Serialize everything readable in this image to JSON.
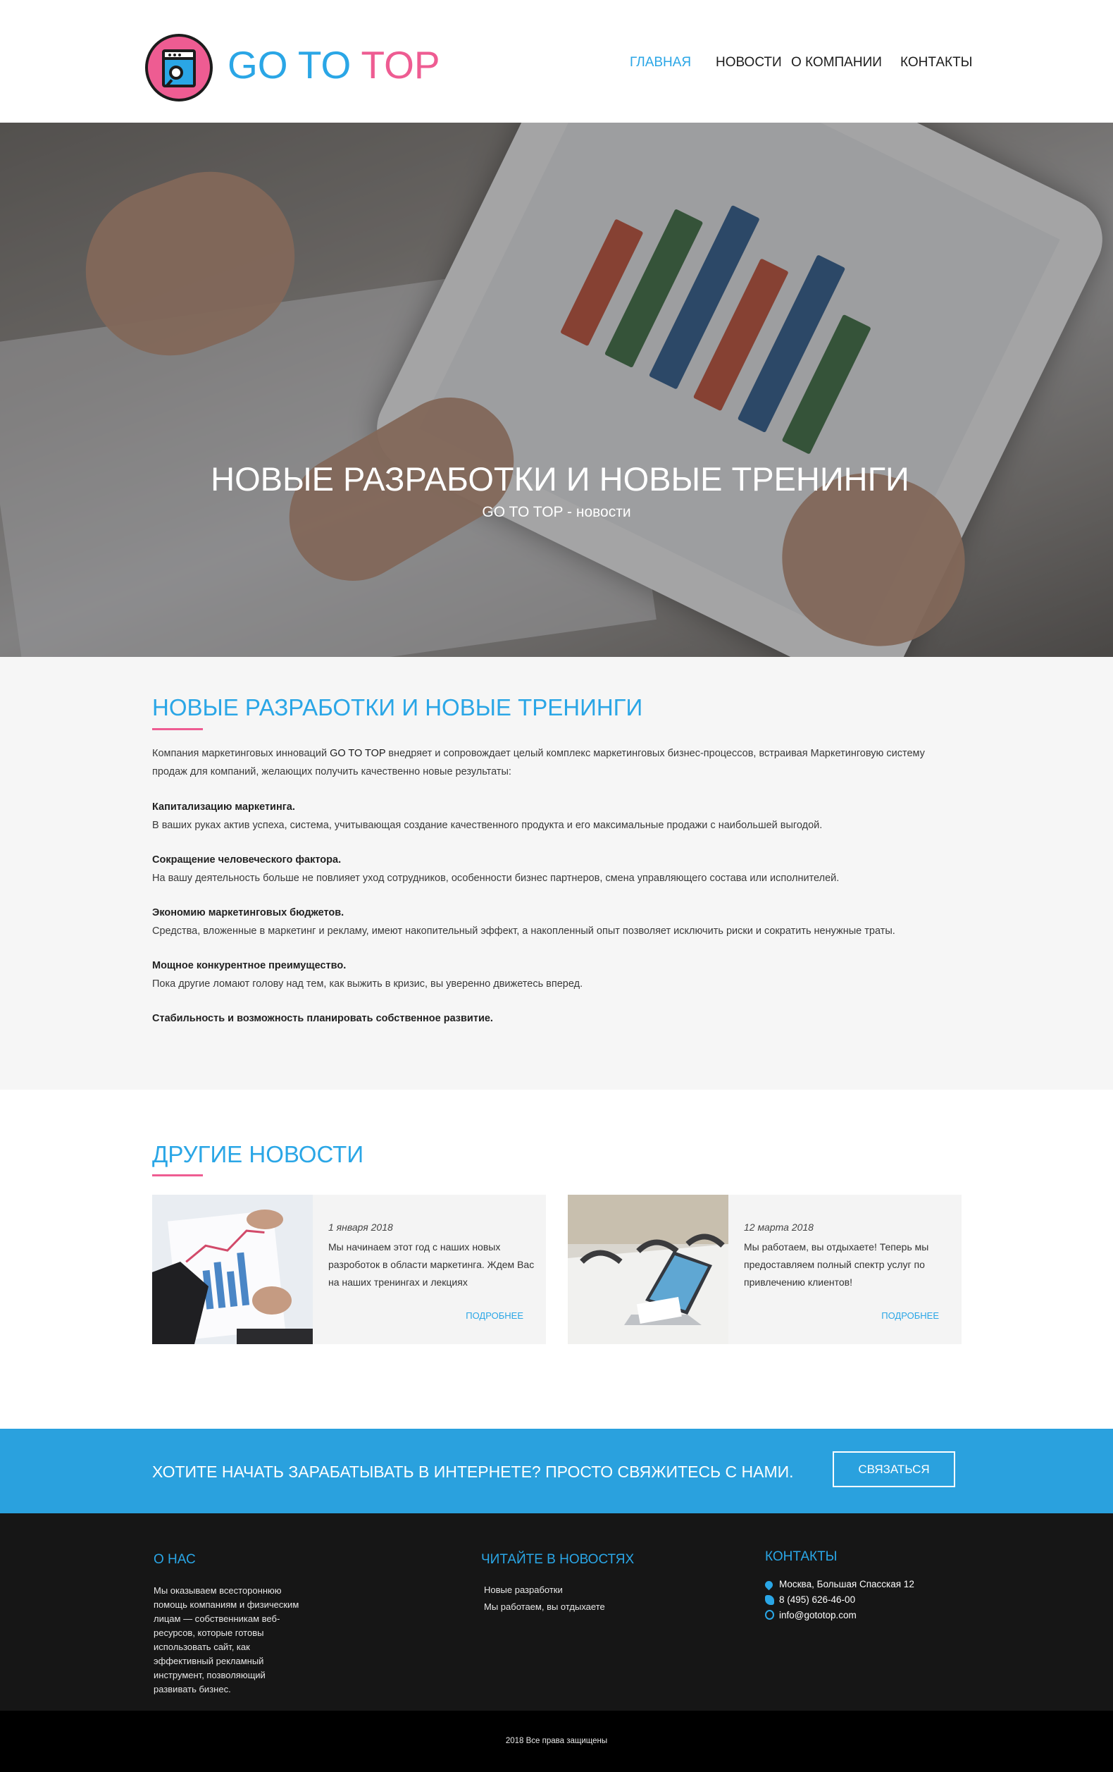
{
  "header": {
    "logo": {
      "word1": "GO TO",
      "word2": "TOP"
    },
    "nav": [
      {
        "label": "ГЛАВНАЯ",
        "active": true
      },
      {
        "label": "НОВОСТИ",
        "active": false
      },
      {
        "label": "О КОМПАНИИ",
        "active": false
      },
      {
        "label": "КОНТАКТЫ",
        "active": false
      }
    ]
  },
  "hero": {
    "title": "НОВЫЕ РАЗРАБОТКИ И НОВЫЕ ТРЕНИНГИ",
    "subtitle": "GO TO TOP - новости"
  },
  "article": {
    "title": "НОВЫЕ РАЗРАБОТКИ И НОВЫЕ ТРЕНИНГИ",
    "intro_before": "Компания маркетинговых инноваций ",
    "intro_brand": "GO TO TOP",
    "intro_after": " внедряет и сопровождает целый комплекс маркетинговых бизнес-процессов, встраивая Маркетинговую систему продаж для компаний, желающих получить качественно новые результаты:",
    "points": [
      {
        "heading": "Капитализацию маркетинга.",
        "text": "В ваших руках актив успеха, система, учитывающая создание качественного продукта и его максимальные продажи с наибольшей выгодой."
      },
      {
        "heading": "Сокращение человеческого фактора.",
        "text": "На вашу деятельность больше не повлияет уход сотрудников, особенности бизнес партнеров, смена управляющего состава или исполнителей."
      },
      {
        "heading": "Экономию маркетинговых бюджетов.",
        "text": "Средства, вложенные в маркетинг и рекламу, имеют накопительный эффект, а накопленный опыт позволяет исключить риски и сократить ненужные траты."
      },
      {
        "heading": "Мощное конкурентное преимущество.",
        "text": "Пока другие ломают голову над тем, как выжить в кризис, вы уверенно движетесь вперед."
      },
      {
        "heading": "Стабильность и возможность планировать собственное развитие.",
        "text": ""
      }
    ]
  },
  "other_news": {
    "title": "ДРУГИЕ НОВОСТИ",
    "cards": [
      {
        "date": "1 января 2018",
        "text": "Мы начинаем этот год с наших новых разроботок в области маркетинга. Ждем Вас на наших тренингах и лекциях",
        "more": "ПОДРОБНЕЕ"
      },
      {
        "date": "12 марта 2018",
        "text": "Мы работаем, вы отдыхаете! Теперь мы предоставляем полный спектр услуг по привлечению клиентов!",
        "more": "ПОДРОБНЕЕ"
      }
    ]
  },
  "cta": {
    "text": "ХОТИТЕ НАЧАТЬ ЗАРАБАТЫВАТЬ В ИНТЕРНЕТЕ? ПРОСТО СВЯЖИТЕСЬ С НАМИ.",
    "button": "СВЯЗАТЬСЯ"
  },
  "footer": {
    "about": {
      "title": "О НАС",
      "text": "Мы оказываем всестороннюю помощь компаниям и физическим лицам — собственникам веб-ресурсов, которые готовы использовать сайт, как эффективный рекламный инструмент, позволяющий развивать бизнес."
    },
    "news": {
      "title": "ЧИТАЙТЕ В НОВОСТЯХ",
      "links": [
        "Новые разработки",
        "Мы работаем, вы отдыхаете"
      ]
    },
    "contacts": {
      "title": "КОНТАКТЫ",
      "address": "Москва, Большая Спасская 12",
      "phone": "8 (495) 626-46-00",
      "email": "info@gototop.com",
      "icons": [
        "location-pin-icon",
        "phone-icon",
        "mail-icon"
      ]
    },
    "copyright": "2018 Все права защищены"
  },
  "colors": {
    "accent": "#2aa6e6",
    "pink": "#ee5c92",
    "cta_bg": "#2aa1de",
    "footer_bg": "#161616"
  }
}
